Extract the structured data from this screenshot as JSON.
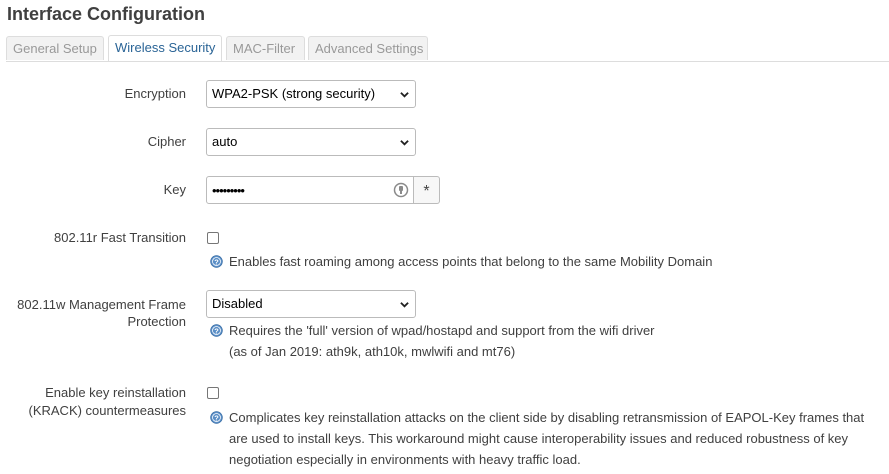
{
  "page": {
    "title": "Interface Configuration"
  },
  "tabs": [
    {
      "label": "General Setup",
      "active": false
    },
    {
      "label": "Wireless Security",
      "active": true
    },
    {
      "label": "MAC-Filter",
      "active": false
    },
    {
      "label": "Advanced Settings",
      "active": false
    }
  ],
  "colors": {
    "active_tab_text": "#2a6496",
    "help_icon": "#5b8fc7"
  },
  "fields": {
    "encryption": {
      "label": "Encryption",
      "value": "WPA2-PSK (strong security)"
    },
    "cipher": {
      "label": "Cipher",
      "value": "auto"
    },
    "key": {
      "label": "Key",
      "value": "•••••••••",
      "reveal_label": "*",
      "icon": "key-reveal-icon"
    },
    "ft": {
      "label": "802.11r Fast Transition",
      "checked": false,
      "help": "Enables fast roaming among access points that belong to the same Mobility Domain"
    },
    "mfp": {
      "label_line1": "802.11w Management Frame",
      "label_line2": "Protection",
      "value": "Disabled",
      "help_line1": "Requires the 'full' version of wpad/hostapd and support from the wifi driver",
      "help_line2": "(as of Jan 2019: ath9k, ath10k, mwlwifi and mt76)"
    },
    "krack": {
      "label_line1": "Enable key reinstallation",
      "label_line2": "(KRACK) countermeasures",
      "checked": false,
      "help_line1": "Complicates key reinstallation attacks on the client side by disabling retransmission of EAPOL-Key frames that",
      "help_line2": "are used to install keys. This workaround might cause interoperability issues and reduced robustness of key",
      "help_line3": "negotiation especially in environments with heavy traffic load."
    }
  }
}
